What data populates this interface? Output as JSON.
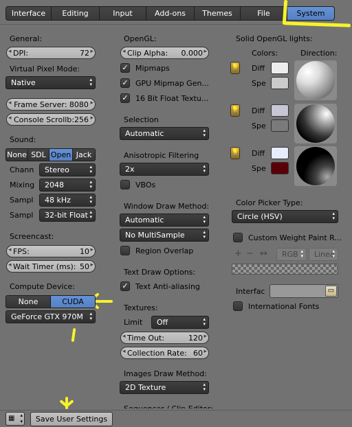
{
  "tabs": [
    {
      "label": "Interface",
      "w": 66
    },
    {
      "label": "Editing",
      "w": 70
    },
    {
      "label": "Input",
      "w": 68
    },
    {
      "label": "Add-ons",
      "w": 70
    },
    {
      "label": "Themes",
      "w": 67
    },
    {
      "label": "File",
      "w": 68
    },
    {
      "label": "System",
      "w": 70,
      "active": true
    }
  ],
  "general": {
    "label": "General:",
    "dpi_label": "DPI:",
    "dpi_value": "72",
    "vpm_label": "Virtual Pixel Mode:",
    "vpm_value": "Native",
    "frame_server": "Frame Server: 8080",
    "console": "Console Scrollb:256"
  },
  "sound": {
    "label": "Sound:",
    "buttons": [
      "None",
      "SDL",
      "Open",
      "Jack"
    ],
    "channels_label": "Chann",
    "channels_value": "Stereo",
    "mixing_label": "Mixing",
    "mixing_value": "2048",
    "sample_rate_label": "Sampl",
    "sample_rate_value": "48 kHz",
    "sample_format_label": "Sampl",
    "sample_format_value": "32-bit Float"
  },
  "screencast": {
    "label": "Screencast:",
    "fps_label": "FPS:",
    "fps_value": "10",
    "wait_label": "Wait Timer (ms):",
    "wait_value": "50"
  },
  "compute": {
    "label": "Compute Device:",
    "none": "None",
    "cuda": "CUDA",
    "device": "GeForce GTX 970M"
  },
  "opengl": {
    "label": "OpenGL:",
    "clip_label": "Clip Alpha:",
    "clip_value": "0.000",
    "mipmaps": "Mipmaps",
    "gpu_mipmap": "GPU Mipmap Gen...",
    "float_tex": "16 Bit Float Textu...",
    "selection_label": "Selection",
    "selection_value": "Automatic",
    "aniso_label": "Anisotropic Filtering",
    "aniso_value": "2x",
    "vbos": "VBOs",
    "wdm_label": "Window Draw Method:",
    "wdm_value": "Automatic",
    "multisample": "No MultiSample",
    "region_overlap": "Region Overlap",
    "text_draw_label": "Text Draw Options:",
    "text_aa": "Text Anti-aliasing",
    "textures_label": "Textures:",
    "limit_label": "Limit",
    "limit_value": "Off",
    "timeout_label": "Time Out:",
    "timeout_value": "120",
    "collection_label": "Collection Rate:",
    "collection_value": "60",
    "images_label": "Images Draw Method:",
    "images_value": "2D Texture",
    "sequencer": "Sequencer / Clip Editor:"
  },
  "lights": {
    "label": "Solid OpenGL lights:",
    "colors_label": "Colors:",
    "direction_label": "Direction:",
    "diff": "Diff",
    "spec": "Spe",
    "colors": [
      {
        "diff": "#ececec",
        "spec": "#cbcbcb"
      },
      {
        "diff": "#c6c6d6",
        "spec": "#7a7a7a"
      },
      {
        "diff": "#e6ecfa",
        "spec": "#5a0008"
      }
    ]
  },
  "color_picker": {
    "label": "Color Picker Type:",
    "value": "Circle (HSV)",
    "weight_paint": "Custom Weight Paint R...",
    "rgb": "RGB",
    "linear": "Linea"
  },
  "interface_field": {
    "label": "Interfac",
    "value": ""
  },
  "intl_fonts": "International Fonts",
  "footer": {
    "save": "Save User Settings"
  }
}
